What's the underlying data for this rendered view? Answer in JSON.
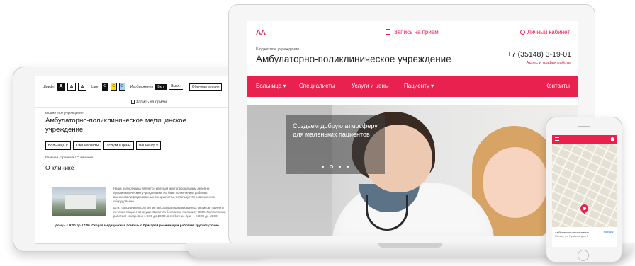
{
  "tablet": {
    "font_label": "Шрифт",
    "font_sizes": [
      "A",
      "A",
      "A"
    ],
    "color_label": "Цвет",
    "colors": [
      "C",
      "C",
      "C"
    ],
    "images_label": "Изображения",
    "images_on": "Вкл.",
    "images_off": "Выкл.",
    "normal_version": "Обычная версия",
    "appointment": "Запись на прием",
    "budget": "Бюджетное учреждение",
    "title": "Амбулаторно-поликлиническое медицинское учреждение",
    "nav": [
      "Больница ▾",
      "Специалисты",
      "Услуги и цены",
      "Пациенту ▾"
    ],
    "breadcrumb": "Главная страница  /  О клинике",
    "page_heading": "О клинике",
    "paragraph1": "Наша поликлиника является крупным многопрофильным лечебно-профилактическим учреждением. На базе поликлиники работают высококвалифицированные специалисты, используется современное оборудование.",
    "paragraph2": "Штат сотрудников состоит из высококвалифицированных медиков. Прием и лечение пациентов осуществляется бесплатно по полису ОМС. Поликлиника работает ежедневно с 8:00 до 20:00, в субботние дни — с 8:00 до 16:00",
    "bottom_line": "дому - с 9:00 до 17:00. Скорая медицинская помощь с бригадой реанимации работает круглосуточно."
  },
  "laptop": {
    "logo": "AA",
    "appointment": "Запись на прием",
    "cabinet": "Личный кабинет",
    "budget": "Бюджетное учреждение",
    "title": "Амбулаторно-поликлиническое учреждение",
    "phone": "+7 (35148) 3-19-01",
    "address_link": "Адрес и график работы",
    "nav": {
      "hospital": "Больница ▾",
      "specialists": "Специалисты",
      "services": "Услуги и цены",
      "patient": "Пациенту ▾",
      "contacts": "Контакты"
    },
    "hero_caption": "Создаем добрую атмосферу для маленьких пациентов",
    "slides_count": 4,
    "active_slide": 2
  },
  "phone": {
    "card_title": "Амбулаторно-поликлинич...",
    "card_subtitle": "Москва, ул. Пушкина, дом 7",
    "route_label": "Маршрут"
  },
  "colors": {
    "accent": "#e8214f",
    "text": "#222222"
  }
}
